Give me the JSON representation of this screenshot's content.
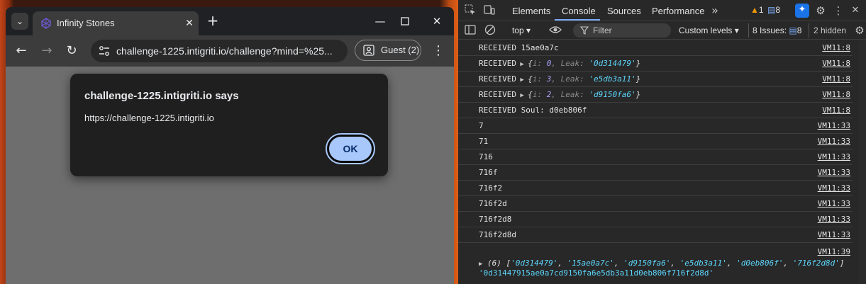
{
  "browser": {
    "tab_title": "Infinity Stones",
    "url": "challenge-1225.intigriti.io/challenge?mind=%25...",
    "profile_label": "Guest (2)",
    "new_tab_symbol": "+",
    "dialog": {
      "title": "challenge-1225.intigriti.io says",
      "message": "https://challenge-1225.intigriti.io",
      "ok_label": "OK"
    }
  },
  "devtools": {
    "tabs": [
      "Elements",
      "Console",
      "Sources",
      "Performance"
    ],
    "active_tab": "Console",
    "warn_count": "1",
    "msg_count": "8",
    "context": "top",
    "filter_placeholder": "Filter",
    "levels_label": "Custom levels",
    "issues_label": "8 Issues:",
    "issues_count": "8",
    "hidden_label": "2 hidden",
    "console": [
      {
        "type": "text",
        "msg": "RECEIVED 15ae0a7c",
        "src": "VM11:8"
      },
      {
        "type": "obj",
        "prefix": "RECEIVED",
        "i": "0",
        "leak": "'0d314479'",
        "src": "VM11:8"
      },
      {
        "type": "obj",
        "prefix": "RECEIVED",
        "i": "3",
        "leak": "'e5db3a11'",
        "src": "VM11:8"
      },
      {
        "type": "obj",
        "prefix": "RECEIVED",
        "i": "2",
        "leak": "'d9150fa6'",
        "src": "VM11:8"
      },
      {
        "type": "text",
        "msg": "RECEIVED Soul: d0eb806f",
        "src": "VM11:8"
      },
      {
        "type": "text",
        "msg": "7",
        "src": "VM11:33"
      },
      {
        "type": "text",
        "msg": "71",
        "src": "VM11:33"
      },
      {
        "type": "text",
        "msg": "716",
        "src": "VM11:33"
      },
      {
        "type": "text",
        "msg": "716f",
        "src": "VM11:33"
      },
      {
        "type": "text",
        "msg": "716f2",
        "src": "VM11:33"
      },
      {
        "type": "text",
        "msg": "716f2d",
        "src": "VM11:33"
      },
      {
        "type": "text",
        "msg": "716f2d8",
        "src": "VM11:33"
      },
      {
        "type": "text",
        "msg": "716f2d8d",
        "src": "VM11:33"
      }
    ],
    "array_src": "VM11:39",
    "array_count": "(6)",
    "array_items": [
      "'0d314479'",
      "'15ae0a7c'",
      "'d9150fa6'",
      "'e5db3a11'",
      "'d0eb806f'",
      "'716f2d8d'"
    ],
    "joined": "'0d31447915ae0a7cd9150fa6e5db3a11d0eb806f716f2d8d'"
  }
}
